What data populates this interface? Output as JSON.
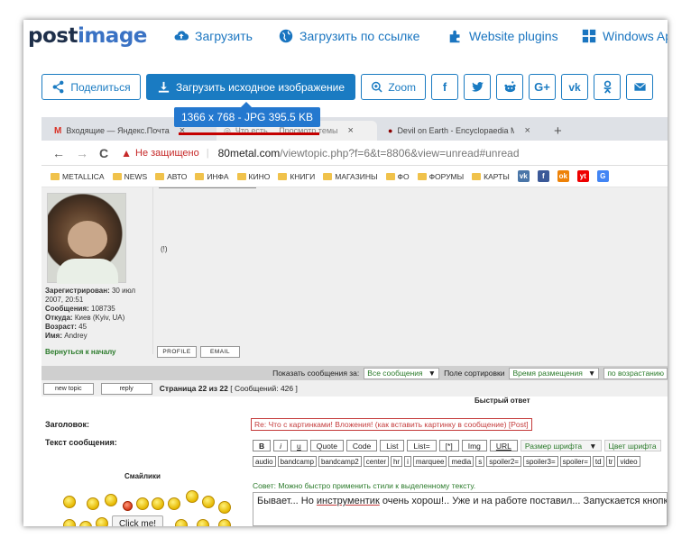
{
  "header": {
    "logo_a": "post",
    "logo_b": "image",
    "nav": [
      {
        "label": "Загрузить",
        "icon": "cloud-upload-icon"
      },
      {
        "label": "Загрузить по ссылке",
        "icon": "globe-icon"
      },
      {
        "label": "Website plugins",
        "icon": "puzzle-icon"
      },
      {
        "label": "Windows App",
        "icon": "windows-icon"
      }
    ]
  },
  "actions": {
    "share": "Поделиться",
    "download": "Загрузить исходное изображение",
    "zoom": "Zoom",
    "social": [
      "f",
      "t",
      "r",
      "G+",
      "vk",
      "ok",
      "mail"
    ]
  },
  "tooltip": "1366 x 768 - JPG 395.5 KB",
  "browser": {
    "tabs": [
      "Входящие — Яндекс.Почта",
      "Что есть ... Просмотр темы",
      "Devil on Earth - Encyclopaedia Metallum"
    ],
    "new_tab": "+",
    "nav_back": "←",
    "nav_forward": "→",
    "nav_reload": "C",
    "insecure": "Не защищено",
    "url_host": "80metal.com",
    "url_path": "/viewtopic.php?f=6&t=8806&view=unread#unread",
    "bookmarks": [
      "METALLICA",
      "NEWS",
      "АВТО",
      "ИНФА",
      "КИНО",
      "КНИГИ",
      "МАГАЗИНЫ",
      "ФО",
      "ФОРУМЫ",
      "КАРТЫ"
    ],
    "bookmark_icons": [
      "vk",
      "f",
      "ok",
      "yt",
      "G"
    ]
  },
  "forum": {
    "user": {
      "registered_label": "Зарегистрирован:",
      "registered": "30 июл 2007, 20:51",
      "posts_label": "Сообщения:",
      "posts": "108735",
      "from_label": "Откуда:",
      "from": "Киев (Kyiv, UA)",
      "age_label": "Возраст:",
      "age": "45",
      "name_label": "Имя:",
      "name": "Andrey"
    },
    "excl": "(!)",
    "back_to_top": "Вернуться к началу",
    "profile": "PROFILE",
    "email": "EMAIL",
    "show_posts_label": "Показать сообщения за:",
    "show_posts_value": "Все сообщения",
    "sort_label": "Поле сортировки",
    "sort_value": "Время размещения",
    "order_value": "по возрастанию",
    "new_topic": "new topic",
    "reply": "reply",
    "page_info": "Страница 22 из 22",
    "post_count": "[ Сообщений: 426 ]",
    "quick_reply": "Быстрый ответ",
    "subject_label": "Заголовок:",
    "subject_value": "Re: Что с картинками! Вложения! (как вставить картинку в сообщение) [Post]",
    "text_label": "Текст сообщения:",
    "toolbar1": [
      "B",
      "i",
      "u",
      "Quote",
      "Code",
      "List",
      "List=",
      "[*]",
      "Img",
      "URL"
    ],
    "font_size": "Размер шрифта",
    "font_color": "Цвет шрифта",
    "toolbar2": [
      "audio",
      "bandcamp",
      "bandcamp2",
      "center",
      "hr",
      "i",
      "marquee",
      "media",
      "s",
      "spoiler2=",
      "spoiler3=",
      "spoiler=",
      "td",
      "tr",
      "video"
    ],
    "hint": "Совет: Можно быстро применить стили к выделенному тексту.",
    "smilies_title": "Смайлики",
    "message_a": "Бывает... Но ",
    "message_u": "инструментик",
    "message_b": " очень хорош!.. Уже и на работе поставил... Запускается кнопкой",
    "click_me": "Click me!"
  }
}
